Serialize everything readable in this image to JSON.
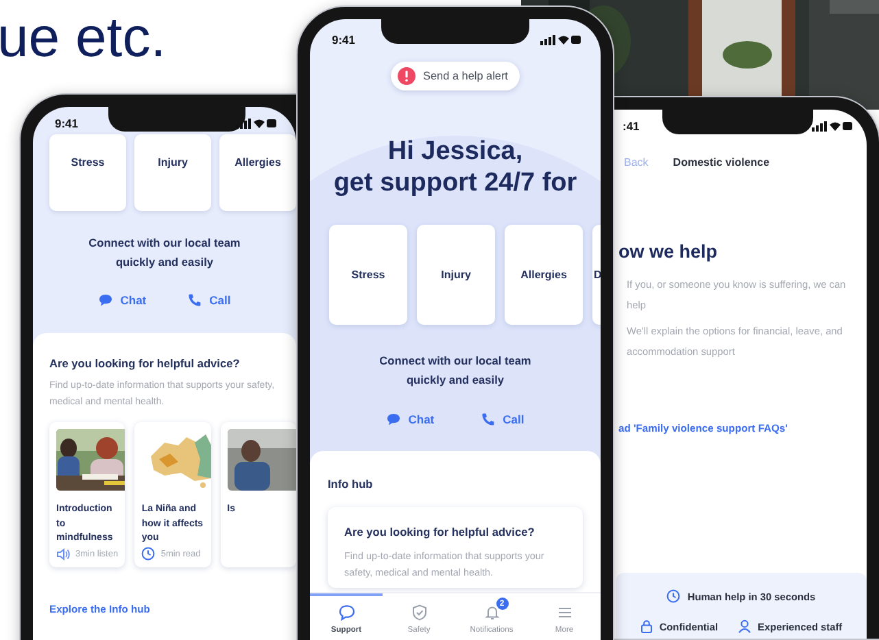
{
  "slide_text": "ue etc.",
  "right_phone": {
    "status_time": ":41",
    "back": "Back",
    "title": "Domestic violence",
    "heading": "ow we help",
    "paragraphs": [
      "If you, or someone you know is suffering, we can help",
      "We'll explain the options for financial, leave, and accommodation support"
    ],
    "link": "ad 'Family violence support FAQs'",
    "features": [
      {
        "kind": "clock",
        "label": "Human help in 30 seconds"
      },
      {
        "kind": "lock",
        "label": "Confidential"
      },
      {
        "kind": "person",
        "label": "Experienced staff"
      }
    ]
  },
  "left_phone": {
    "status_time": "9:41",
    "topics": [
      "Stress",
      "Injury",
      "Allergies"
    ],
    "connect_text": "Connect with our local team quickly and easily",
    "actions": [
      {
        "kind": "chat",
        "label": "Chat"
      },
      {
        "kind": "call",
        "label": "Call"
      }
    ],
    "advice_title": "Are you looking for helpful advice?",
    "advice_text": "Find up-to-date information that supports your safety, medical and mental health.",
    "articles": [
      {
        "kind": "listen",
        "title": "Introduction to mindfulness",
        "meta": "3min listen"
      },
      {
        "kind": "read",
        "title": "La Niña and how it affects you",
        "meta": "5min read"
      },
      {
        "title": "Is"
      }
    ],
    "explore_link": "Explore the Info hub"
  },
  "center_phone": {
    "status_time": "9:41",
    "help_alert": "Send a help alert",
    "greeting": "Hi Jessica,",
    "subheading": "get support 24/7 for",
    "topics": [
      "Stress",
      "Injury",
      "Allergies",
      "D"
    ],
    "connect_text": "Connect with our local team quickly and easily",
    "actions": [
      {
        "kind": "chat",
        "label": "Chat"
      },
      {
        "kind": "call",
        "label": "Call"
      }
    ],
    "section_title": "Info hub",
    "advice_title": "Are you looking for helpful advice?",
    "advice_text": "Find up-to-date information that supports your safety, medical and mental health.",
    "nav": [
      {
        "kind": "support",
        "label": "Support",
        "selected": true
      },
      {
        "kind": "safety",
        "label": "Safety",
        "selected": false
      },
      {
        "kind": "notifications",
        "label": "Notifications",
        "selected": false,
        "badge": "2"
      },
      {
        "kind": "more",
        "label": "More",
        "selected": false
      }
    ]
  }
}
